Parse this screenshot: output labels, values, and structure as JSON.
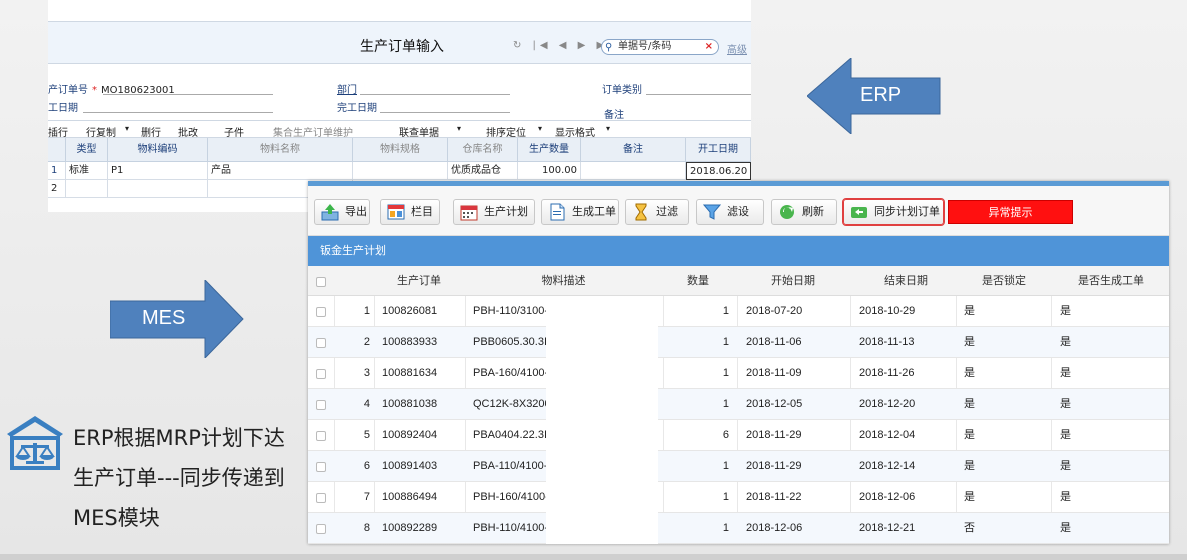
{
  "erp": {
    "title": "生产订单输入",
    "search_placeholder": "单据号/条码",
    "advanced": "高级",
    "fields": {
      "order_no_label": "产订单号",
      "order_no_value": "MO180623001",
      "start_date_label": "工日期",
      "dept_label": "部门",
      "finish_date_label": "完工日期",
      "order_type_label": "订单类别",
      "remark_label": "备注"
    },
    "toolbar": [
      "插行",
      "行复制",
      "删行",
      "批改",
      "子件",
      "集合生产订单维护",
      "联查单据",
      "排序定位",
      "显示格式"
    ],
    "columns": [
      "类型",
      "物料编码",
      "物料名称",
      "物料规格",
      "仓库名称",
      "生产数量",
      "备注",
      "开工日期"
    ],
    "rows": [
      {
        "num": "1",
        "type": "标准",
        "code": "P1",
        "name": "产品",
        "warehouse": "优质成品仓",
        "qty": "100.00",
        "date": "2018.06.20"
      },
      {
        "num": "2",
        "type": "",
        "code": "",
        "name": "",
        "warehouse": "",
        "qty": "",
        "date": ""
      }
    ]
  },
  "arrows": {
    "erp_label": "ERP",
    "mes_label": "MES"
  },
  "mes": {
    "toolbar": {
      "export": "导出",
      "columns": "栏目",
      "production_plan": "生产计划",
      "generate_work_order": "生成工单",
      "filter": "过滤",
      "filter_settings": "滤设",
      "refresh": "刷新",
      "sync_plan_order": "同步计划订单",
      "exception_alert": "异常提示"
    },
    "panel_title": "钣金生产计划",
    "columns": [
      "生产订单",
      "物料描述",
      "数量",
      "开始日期",
      "结束日期",
      "是否锁定",
      "是否生成工单"
    ],
    "rows": [
      {
        "num": "1",
        "order": "100826081",
        "desc": "PBH-110/3100-",
        "qty": "1",
        "start": "2018-07-20",
        "end": "2018-10-29",
        "locked": "是",
        "generated": "是"
      },
      {
        "num": "2",
        "order": "100883933",
        "desc": "PBB0605.30.3I",
        "qty": "1",
        "start": "2018-11-06",
        "end": "2018-11-13",
        "locked": "是",
        "generated": "是"
      },
      {
        "num": "3",
        "order": "100881634",
        "desc": "PBA-160/4100-",
        "qty": "1",
        "start": "2018-11-09",
        "end": "2018-11-26",
        "locked": "是",
        "generated": "是"
      },
      {
        "num": "4",
        "order": "100881038",
        "desc": "QC12K-8X3200",
        "qty": "1",
        "start": "2018-12-05",
        "end": "2018-12-20",
        "locked": "是",
        "generated": "是"
      },
      {
        "num": "5",
        "order": "100892404",
        "desc": "PBA0404.22.3I",
        "qty": "6",
        "start": "2018-11-29",
        "end": "2018-12-04",
        "locked": "是",
        "generated": "是"
      },
      {
        "num": "6",
        "order": "100891403",
        "desc": "PBA-110/4100-",
        "qty": "1",
        "start": "2018-11-29",
        "end": "2018-12-14",
        "locked": "是",
        "generated": "是"
      },
      {
        "num": "7",
        "order": "100886494",
        "desc": "PBH-160/4100-",
        "qty": "1",
        "start": "2018-11-22",
        "end": "2018-12-06",
        "locked": "是",
        "generated": "是"
      },
      {
        "num": "8",
        "order": "100892289",
        "desc": "PBH-110/4100-",
        "qty": "1",
        "start": "2018-12-06",
        "end": "2018-12-21",
        "locked": "否",
        "generated": "是"
      }
    ]
  },
  "description": {
    "line1": "ERP根据MRP计划下达",
    "line2": "生产订单---同步传递到",
    "line3": "MES模块"
  },
  "colors": {
    "arrow_blue": "#4f81bd",
    "mes_blue": "#4f94d8",
    "alert_red": "#ff1010",
    "icon_blue": "#3a7fc1"
  }
}
